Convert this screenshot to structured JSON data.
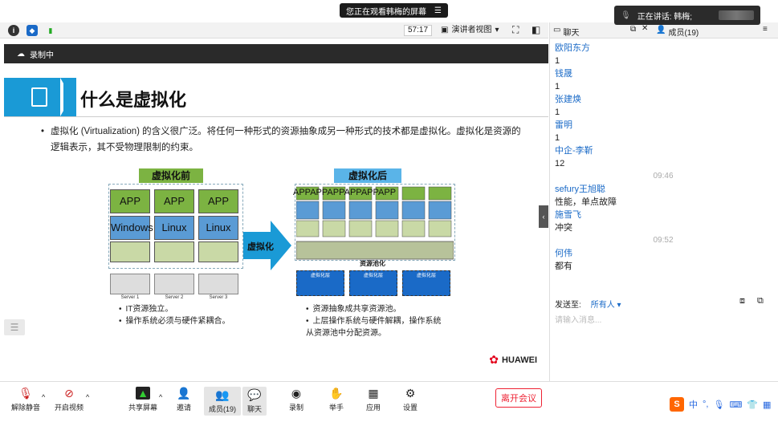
{
  "top": {
    "viewing": "您正在观看韩梅的屏幕",
    "speaking": "正在讲话: 韩梅;"
  },
  "toolbar": {
    "timer": "57:17",
    "presenter_view": "演讲者视图"
  },
  "rec": {
    "label": "录制中"
  },
  "slide": {
    "title": "什么是虚拟化",
    "bullet": "虚拟化 (Virtualization) 的含义很广泛。将任何一种形式的资源抽象成另一种形式的技术都是虚拟化。虚拟化是资源的逻辑表示，其不受物理限制的约束。",
    "before_label": "虚拟化前",
    "after_label": "虚拟化后",
    "arrow_label": "虚拟化",
    "app": "APP",
    "os": [
      "Windows",
      "Linux",
      "Linux"
    ],
    "servers": [
      "Server 1",
      "Server 2",
      "Server 3"
    ],
    "pool_label": "资源池化",
    "vm_label": "虚拟化层",
    "before_notes": [
      "IT资源独立。",
      "操作系统必须与硬件紧耦合。"
    ],
    "after_notes": [
      "资源抽象成共享资源池。",
      "上层操作系统与硬件解耦，操作系统从资源池中分配资源。"
    ],
    "brand": "HUAWEI"
  },
  "bottom": {
    "mute": "解除静音",
    "video": "开启视频",
    "share": "共享屏幕",
    "invite": "邀请",
    "members": "成员(19)",
    "chat": "聊天",
    "record": "录制",
    "raise": "举手",
    "apps": "应用",
    "settings": "设置",
    "leave": "离开会议"
  },
  "chat": {
    "tab_chat": "聊天",
    "tab_members": "成员(19)",
    "messages": [
      {
        "who": "欧阳东方",
        "text": "1"
      },
      {
        "who": "钱晟",
        "text": "1"
      },
      {
        "who": "张建焕",
        "text": "1"
      },
      {
        "who": "雷明",
        "text": "1"
      },
      {
        "who": "中企-李靳",
        "text": "12"
      },
      {
        "time": "09:46"
      },
      {
        "who": "sefury王旭聪",
        "text": "性能，单点故障"
      },
      {
        "who": "施雪飞",
        "text": "冲突"
      },
      {
        "time": "09:52"
      },
      {
        "who": "何伟",
        "text": "都有"
      }
    ],
    "send_to_label": "发送至:",
    "send_to_value": "所有人",
    "placeholder": "请输入消息..."
  },
  "ime": {
    "label": "中"
  }
}
